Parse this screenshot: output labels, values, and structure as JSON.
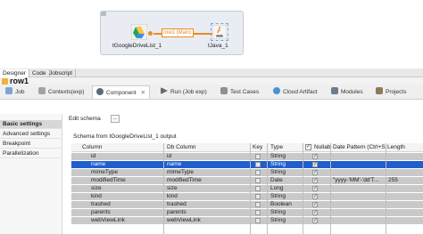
{
  "canvas": {
    "components": [
      {
        "label": "tGoogleDriveList_1"
      },
      {
        "label": "tJava_1"
      }
    ],
    "link_label": "row1 (Main)"
  },
  "designer_tabs": [
    "Designer",
    "Code",
    "Jobscript"
  ],
  "row_title": "row1",
  "component_tabs": [
    {
      "label": "Job",
      "icon": "job-icon"
    },
    {
      "label": "Contexts(exp)",
      "icon": "contexts-icon"
    },
    {
      "label": "Component",
      "icon": "component-icon",
      "active": true
    },
    {
      "label": "Run (Job exp)",
      "icon": "run-icon"
    },
    {
      "label": "Test Cases",
      "icon": "test-cases-icon"
    },
    {
      "label": "Cloud Artifact",
      "icon": "cloud-icon"
    },
    {
      "label": "Modules",
      "icon": "modules-icon"
    },
    {
      "label": "Projects",
      "icon": "projects-icon"
    }
  ],
  "settings_nav": [
    "Basic settings",
    "Advanced settings",
    "Breakpoint",
    "Parallelization"
  ],
  "edit_schema_label": "Edit schema",
  "edit_schema_button": "...",
  "schema_caption": "Schema from tGoogleDriveList_1 output",
  "table": {
    "headers": {
      "column": "Column",
      "db_column": "Db Column",
      "key": "Key",
      "type": "Type",
      "nullable": "Nullab",
      "date_pattern": "Date Pattern (Ctrl+S",
      "length": "Length"
    },
    "rows": [
      {
        "column": "id",
        "db_column": "id",
        "type": "String",
        "nullable": true,
        "date_pattern": "",
        "length": ""
      },
      {
        "column": "name",
        "db_column": "name",
        "type": "String",
        "nullable": true,
        "date_pattern": "",
        "length": "",
        "selected": true
      },
      {
        "column": "mimeType",
        "db_column": "mimeType",
        "type": "String",
        "nullable": true,
        "date_pattern": "",
        "length": ""
      },
      {
        "column": "modifiedTime",
        "db_column": "modifiedTime",
        "type": "Date",
        "nullable": true,
        "date_pattern": "\"yyyy-'MM'-'dd'T...",
        "length": "255"
      },
      {
        "column": "size",
        "db_column": "size",
        "type": "Long",
        "nullable": true,
        "date_pattern": "",
        "length": ""
      },
      {
        "column": "kind",
        "db_column": "kind",
        "type": "String",
        "nullable": true,
        "date_pattern": "",
        "length": ""
      },
      {
        "column": "trashed",
        "db_column": "trashed",
        "type": "Boolean",
        "nullable": true,
        "date_pattern": "",
        "length": ""
      },
      {
        "column": "parents",
        "db_column": "parents",
        "type": "String",
        "nullable": true,
        "date_pattern": "",
        "length": ""
      },
      {
        "column": "webViewLink",
        "db_column": "webViewLink",
        "type": "String",
        "nullable": true,
        "date_pattern": "",
        "length": ""
      }
    ]
  },
  "colors": {
    "selection": "#1f5ecf",
    "row_link": "#e98b23"
  }
}
